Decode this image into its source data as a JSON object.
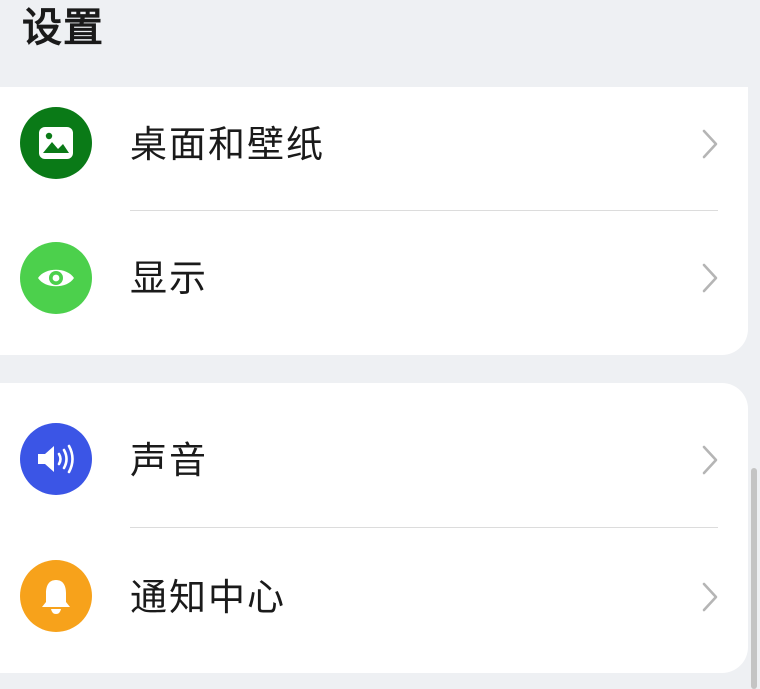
{
  "header": {
    "title": "设置"
  },
  "groups": [
    {
      "items": [
        {
          "label": "桌面和壁纸",
          "icon": "wallpaper-icon",
          "color": "#0a7a17"
        },
        {
          "label": "显示",
          "icon": "eye-icon",
          "color": "#4cd04c"
        }
      ]
    },
    {
      "items": [
        {
          "label": "声音",
          "icon": "speaker-icon",
          "color": "#3b55e6"
        },
        {
          "label": "通知中心",
          "icon": "bell-icon",
          "color": "#f7a21b"
        }
      ]
    }
  ],
  "chevron_icon": "chevron-right-icon"
}
